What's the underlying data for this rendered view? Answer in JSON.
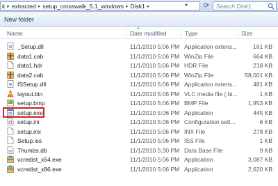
{
  "address_bar": {
    "crumbs": [
      "k",
      "extracted",
      "setup_crosswalk_5.1_windows",
      "Disk1"
    ],
    "search_placeholder": "Search Disk1"
  },
  "toolbar": {
    "new_folder_label": "New folder"
  },
  "columns": {
    "name": "Name",
    "date": "Date modified",
    "type": "Type",
    "size": "Size"
  },
  "files": [
    {
      "name": "_Setup.dll",
      "date": "11/1/2010 5:06 PM",
      "type": "Application extens...",
      "size": "161 KB",
      "icon": "dll-icon"
    },
    {
      "name": "data1.cab",
      "date": "11/1/2010 5:06 PM",
      "type": "WinZip File",
      "size": "664 KB",
      "icon": "cab-icon"
    },
    {
      "name": "data1.hdr",
      "date": "11/1/2010 5:06 PM",
      "type": "HDR File",
      "size": "218 KB",
      "icon": "file-icon"
    },
    {
      "name": "data2.cab",
      "date": "11/1/2010 5:06 PM",
      "type": "WinZip File",
      "size": "58,001 KB",
      "icon": "cab-icon"
    },
    {
      "name": "ISSetup.dll",
      "date": "11/1/2010 5:06 PM",
      "type": "Application extens...",
      "size": "481 KB",
      "icon": "dll-icon"
    },
    {
      "name": "layout.bin",
      "date": "11/1/2010 5:06 PM",
      "type": "VLC media file (.bi...",
      "size": "1 KB",
      "icon": "vlc-icon"
    },
    {
      "name": "setup.bmp",
      "date": "11/1/2010 5:06 PM",
      "type": "BMP File",
      "size": "1,953 KB",
      "icon": "bmp-icon"
    },
    {
      "name": "setup.exe",
      "date": "11/1/2010 5:06 PM",
      "type": "Application",
      "size": "445 KB",
      "icon": "exe-icon",
      "selected": true
    },
    {
      "name": "setup.ini",
      "date": "11/1/2010 5:06 PM",
      "type": "Configuration sett...",
      "size": "6 KB",
      "icon": "ini-icon"
    },
    {
      "name": "setup.inx",
      "date": "11/1/2010 5:06 PM",
      "type": "INX File",
      "size": "278 KB",
      "icon": "file-icon"
    },
    {
      "name": "Setup.iss",
      "date": "11/1/2010 5:06 PM",
      "type": "ISS File",
      "size": "1 KB",
      "icon": "file-icon"
    },
    {
      "name": "Thumbs.db",
      "date": "11/1/2010 5:30 PM",
      "type": "Data Base File",
      "size": "9 KB",
      "icon": "db-icon"
    },
    {
      "name": "vcredist_x64.exe",
      "date": "11/1/2010 5:06 PM",
      "type": "Application",
      "size": "3,087 KB",
      "icon": "installer-icon"
    },
    {
      "name": "vcredist_x86.exe",
      "date": "11/1/2010 5:06 PM",
      "type": "Application",
      "size": "2,620 KB",
      "icon": "installer-icon"
    }
  ],
  "colors": {
    "selection_outline": "#d02020",
    "toolbar_text": "#1e395b",
    "header_text": "#4c607a"
  }
}
